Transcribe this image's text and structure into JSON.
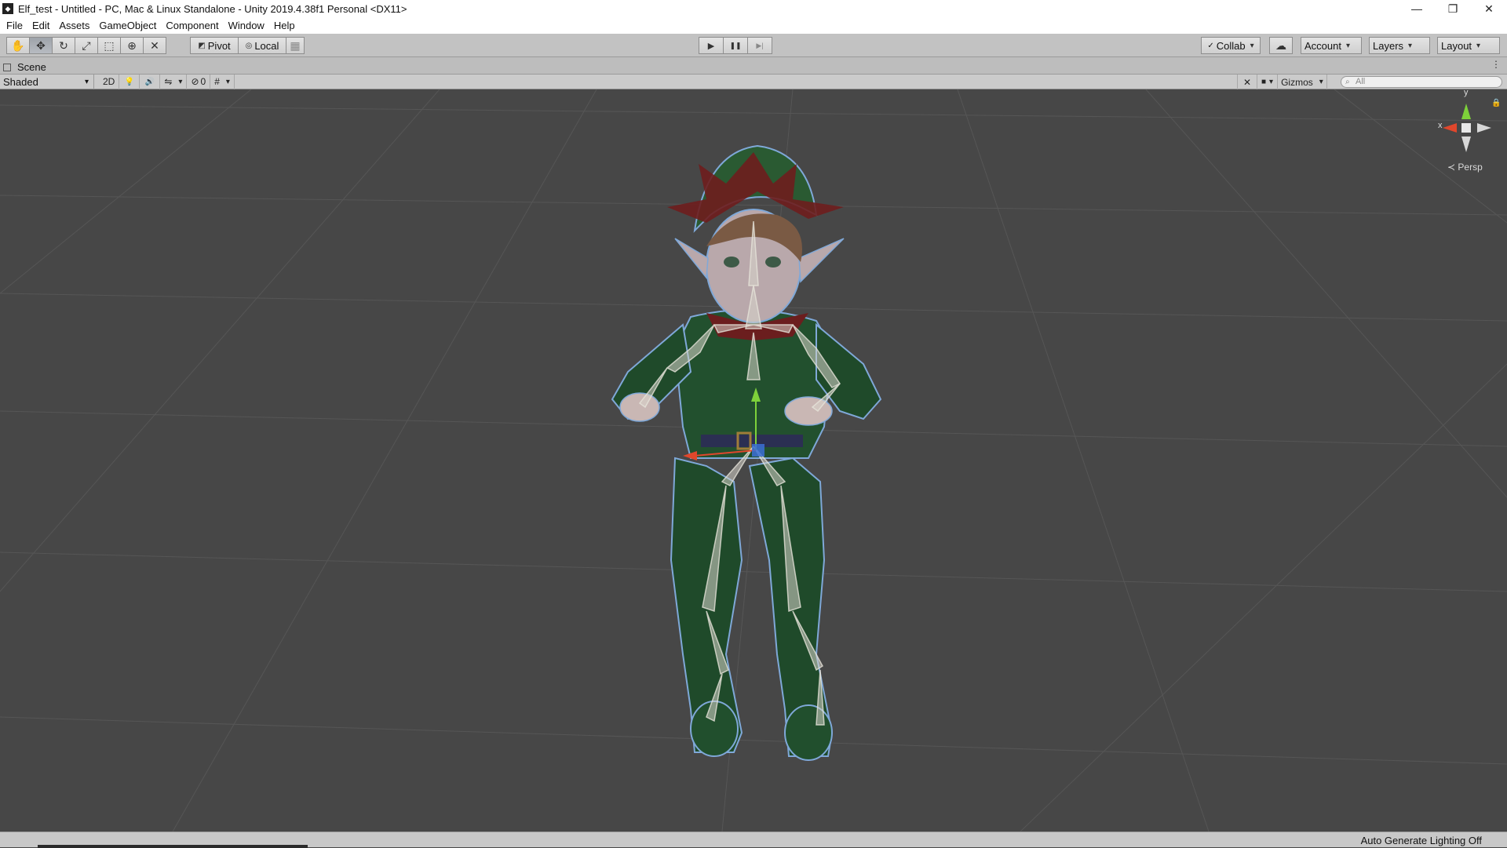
{
  "window": {
    "title": "Elf_test - Untitled - PC, Mac & Linux Standalone - Unity 2019.4.38f1 Personal <DX11>",
    "controls": {
      "minimize": "—",
      "restore": "❐",
      "close": "✕"
    }
  },
  "menu": {
    "items": [
      "File",
      "Edit",
      "Assets",
      "GameObject",
      "Component",
      "Window",
      "Help"
    ]
  },
  "toolbar": {
    "tools": [
      {
        "icon": "hand-tool-icon",
        "glyph": "✋"
      },
      {
        "icon": "move-tool-icon",
        "glyph": "✥"
      },
      {
        "icon": "rotate-tool-icon",
        "glyph": "↻"
      },
      {
        "icon": "scale-tool-icon",
        "glyph": "⤢"
      },
      {
        "icon": "rect-tool-icon",
        "glyph": "⬚"
      },
      {
        "icon": "transform-tool-icon",
        "glyph": "⊕"
      },
      {
        "icon": "custom-tool-icon",
        "glyph": "✕"
      }
    ],
    "pivot_label": "Pivot",
    "local_label": "Local",
    "snap_glyph": "▦",
    "play_glyph": "▶",
    "pause_glyph": "❚❚",
    "step_glyph": "▶|",
    "collab_label": "Collab",
    "cloud_glyph": "☁",
    "account_label": "Account",
    "layers_label": "Layers",
    "layout_label": "Layout"
  },
  "scene": {
    "tab_label": "Scene",
    "tab_menu_glyph": "⋮",
    "shading_mode": "Shaded",
    "mode_2d_label": "2D",
    "lighting_glyph": "💡",
    "audio_glyph": "🔊",
    "effects_glyph": "⇋",
    "hidden_glyph": "⊘",
    "hidden_count": "0",
    "grid_glyph": "#",
    "tools_glyph": "✕",
    "camera_glyph": "■",
    "gizmos_label": "Gizmos",
    "search_placeholder": "All",
    "search_glyph": "⌕"
  },
  "viewport": {
    "axis_y_label": "y",
    "axis_x_label": "x",
    "projection_label": "≺ Persp",
    "lock_glyph": "🔒"
  },
  "status": {
    "text": "Auto Generate Lighting Off"
  },
  "colors": {
    "titlebar_bg": "#ffffff",
    "toolbar_bg": "#c2c2c2",
    "viewport_bg": "#474747",
    "elf_green": "#1f4a2a",
    "elf_red": "#7a1f1f",
    "bone_color": "#d9d6cc",
    "axis_x": "#e0472c",
    "axis_y": "#7ed23a",
    "axis_z": "#3b6fd6"
  }
}
